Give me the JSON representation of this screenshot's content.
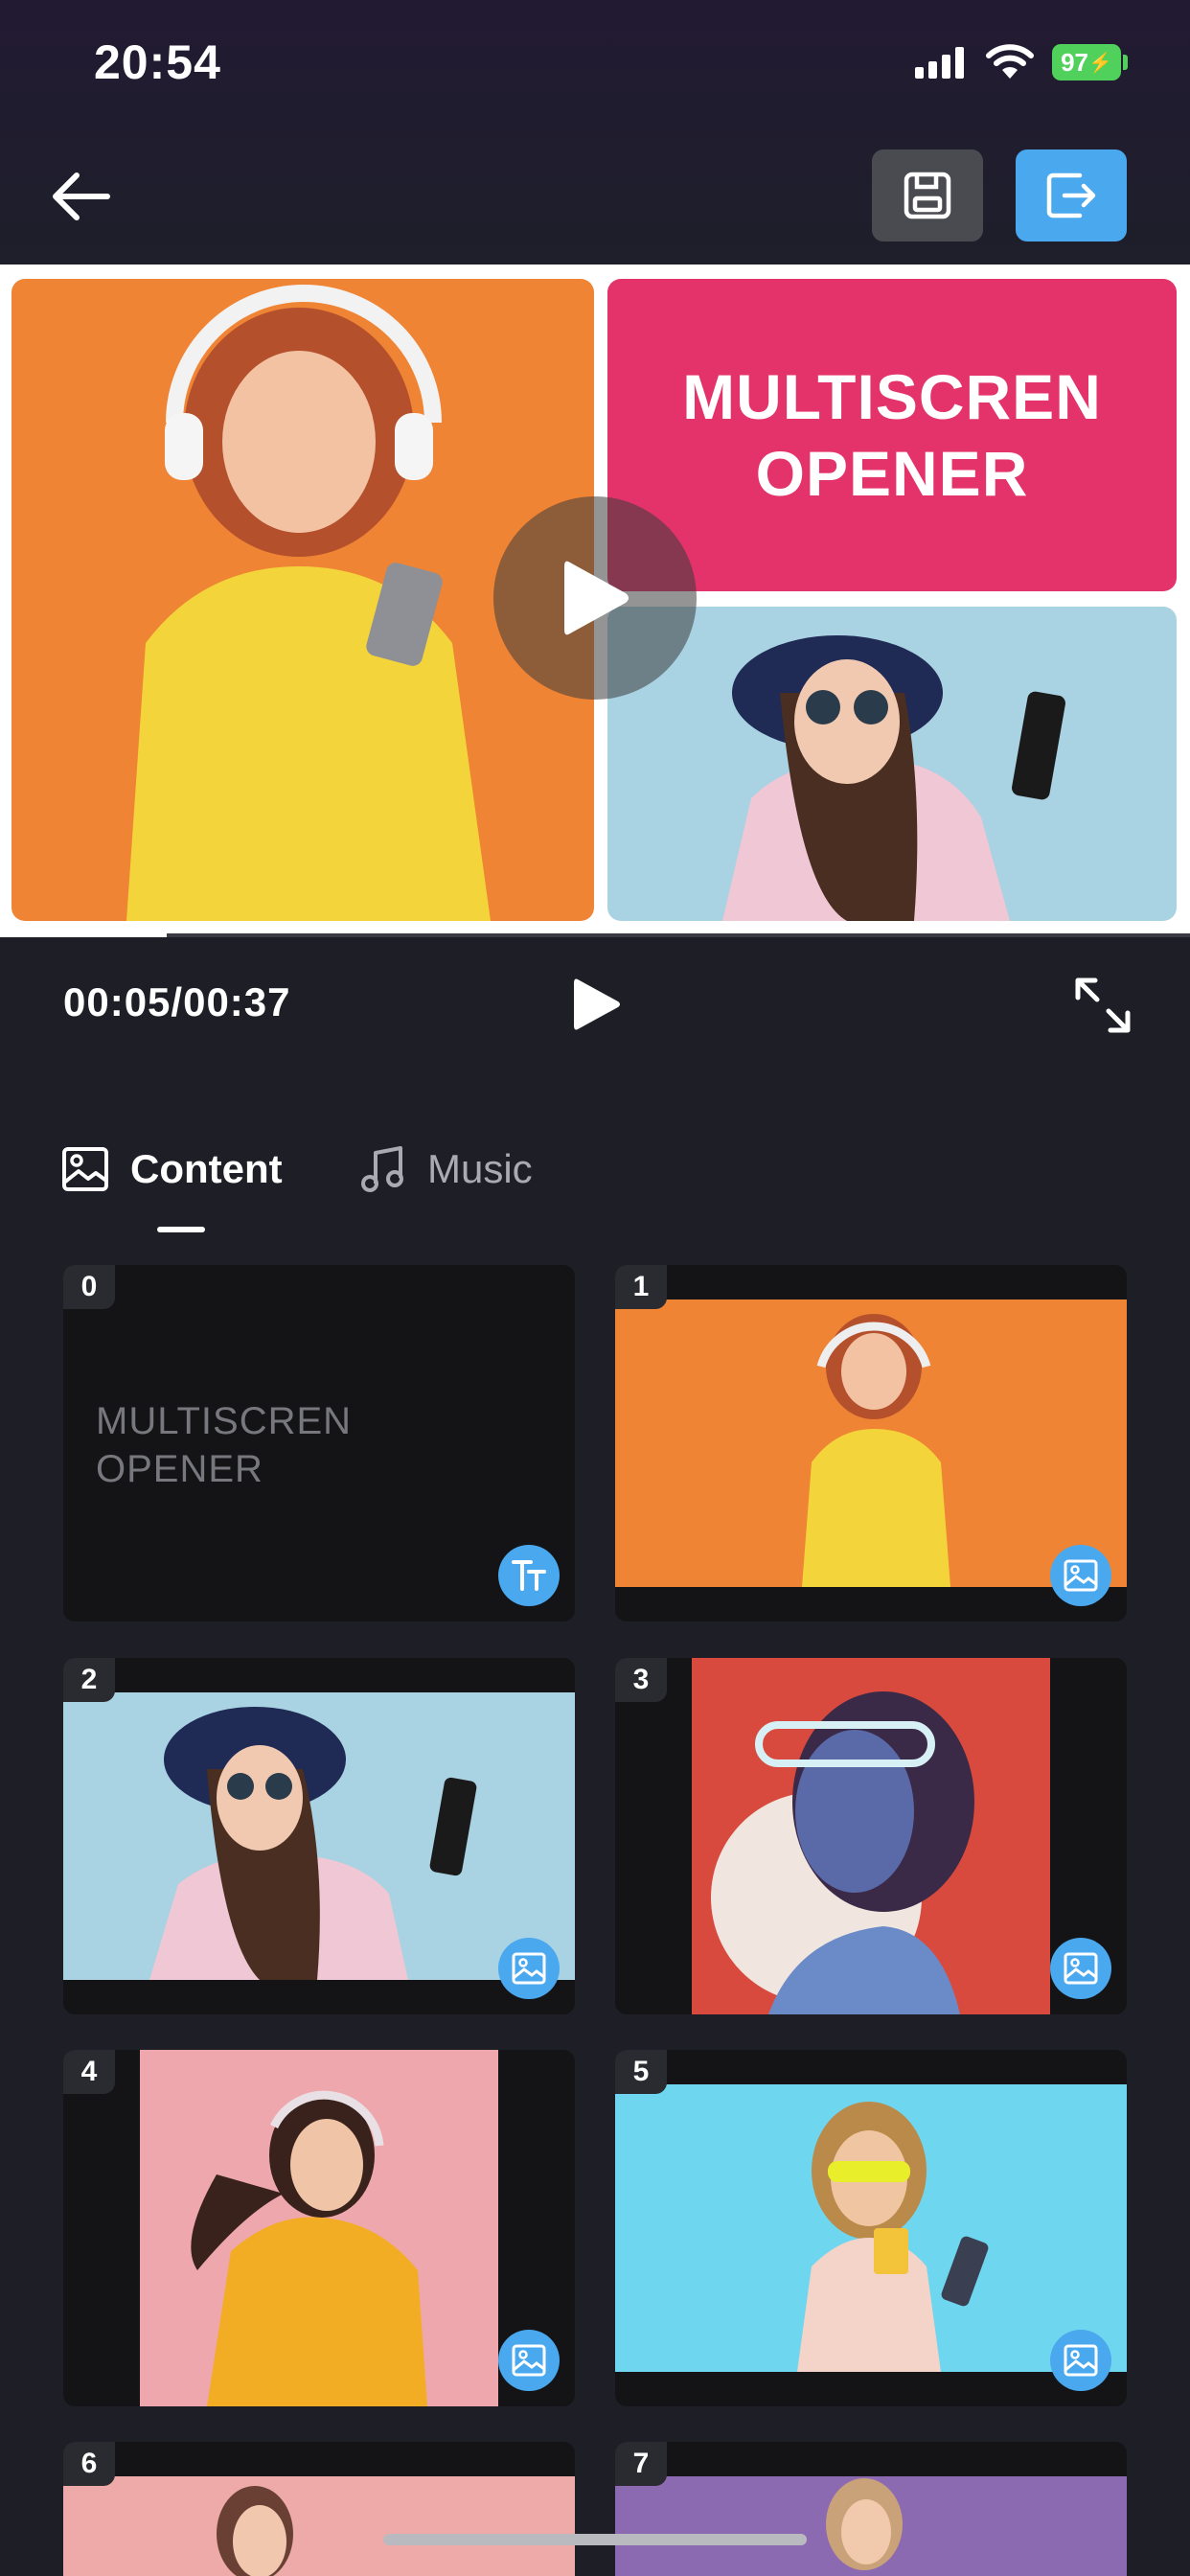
{
  "status_bar": {
    "time": "20:54",
    "battery": "97"
  },
  "preview": {
    "title_line1": "MULTISCREN",
    "title_line2": "OPENER",
    "progress": 0.14
  },
  "player": {
    "timecode": "00:05/00:37"
  },
  "tabs": [
    {
      "label": "Content",
      "icon": "image-icon",
      "active": true
    },
    {
      "label": "Music",
      "icon": "music-note-icon",
      "active": false
    }
  ],
  "content_items": [
    {
      "index": "0",
      "kind": "text",
      "line1": "MULTISCREN",
      "line2": "OPENER",
      "badge_icon": "text-icon"
    },
    {
      "index": "1",
      "kind": "image",
      "badge_icon": "image-icon"
    },
    {
      "index": "2",
      "kind": "image",
      "badge_icon": "image-icon"
    },
    {
      "index": "3",
      "kind": "image",
      "badge_icon": "image-icon"
    },
    {
      "index": "4",
      "kind": "image",
      "badge_icon": "image-icon"
    },
    {
      "index": "5",
      "kind": "image",
      "badge_icon": "image-icon"
    },
    {
      "index": "6",
      "kind": "image"
    },
    {
      "index": "7",
      "kind": "image"
    }
  ],
  "colors": {
    "accent_blue": "#4aa8ef",
    "title_pink": "#e3336a",
    "orange_bg": "#ef8434",
    "battery_green": "#4fd15b"
  }
}
